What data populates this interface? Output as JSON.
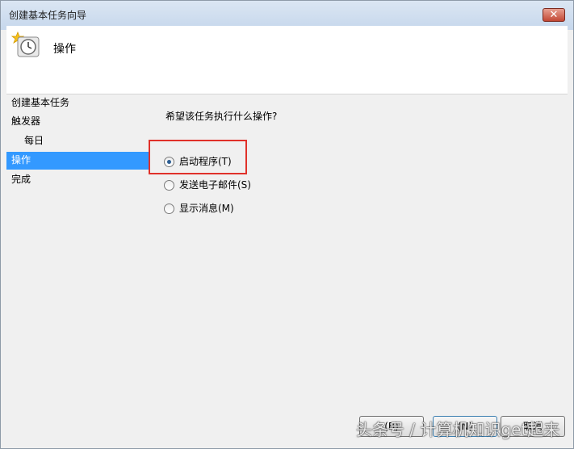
{
  "window": {
    "title": "创建基本任务向导",
    "close_label": "✕"
  },
  "header": {
    "title": "操作"
  },
  "sidebar": {
    "items": [
      {
        "label": "创建基本任务"
      },
      {
        "label": "触发器"
      },
      {
        "label": "每日"
      },
      {
        "label": "操作"
      },
      {
        "label": "完成"
      }
    ]
  },
  "content": {
    "prompt": "希望该任务执行什么操作?",
    "options": [
      {
        "label": "启动程序(T)",
        "checked": true
      },
      {
        "label": "发送电子邮件(S)",
        "checked": false
      },
      {
        "label": "显示消息(M)",
        "checked": false
      }
    ]
  },
  "buttons": {
    "back": "(B)",
    "next": "(N)",
    "cancel": "取消"
  },
  "watermark": "头条号 / 计算机知识get起来",
  "colors": {
    "selection": "#3399ff",
    "highlight_box": "#e0312a"
  }
}
